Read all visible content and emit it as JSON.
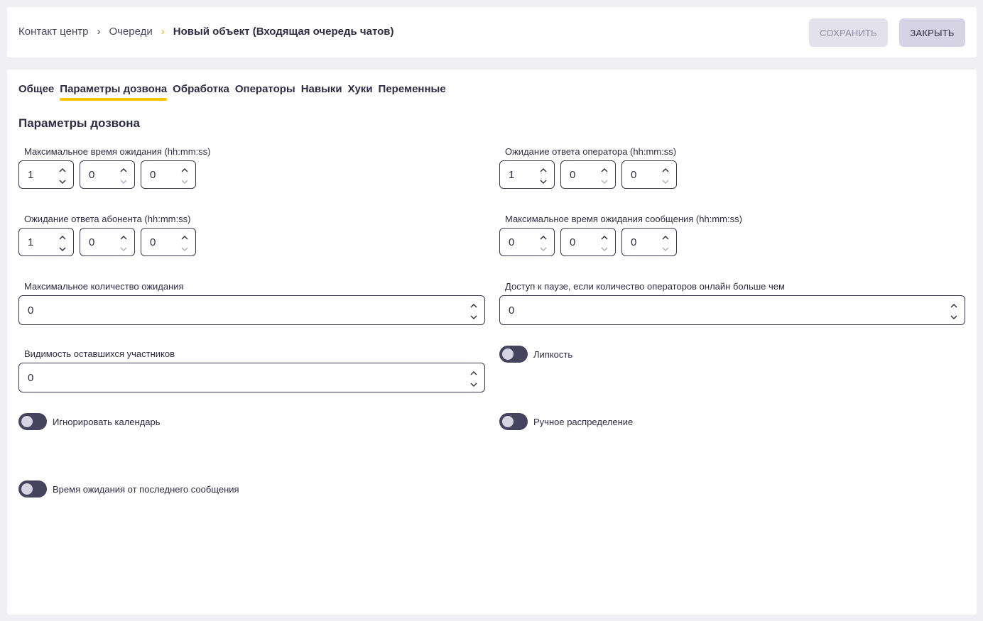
{
  "breadcrumb": {
    "items": [
      "Контакт центр",
      "Очереди"
    ],
    "current": "Новый объект (Входящая очередь чатов)",
    "separator": "›"
  },
  "actions": {
    "save_label": "СОХРАНИТЬ",
    "close_label": "ЗАКРЫТЬ"
  },
  "tabs": [
    "Общее",
    "Параметры дозвона",
    "Обработка",
    "Операторы",
    "Навыки",
    "Хуки",
    "Переменные"
  ],
  "active_tab": "Параметры дозвона",
  "section_title": "Параметры дозвона",
  "fields": {
    "max_wait_time": {
      "label": "Максимальное время ожидания (hh:mm:ss)",
      "hh": "1",
      "mm": "0",
      "ss": "0"
    },
    "operator_answer_wait": {
      "label": "Ожидание ответа оператора (hh:mm:ss)",
      "hh": "1",
      "mm": "0",
      "ss": "0"
    },
    "subscriber_answer_wait": {
      "label": "Ожидание ответа абонента (hh:mm:ss)",
      "hh": "1",
      "mm": "0",
      "ss": "0"
    },
    "max_message_wait": {
      "label": "Максимальное время ожидания сообщения (hh:mm:ss)",
      "hh": "0",
      "mm": "0",
      "ss": "0"
    },
    "max_wait_count": {
      "label": "Максимальное количество ожидания",
      "value": "0"
    },
    "pause_access": {
      "label": "Доступ к паузе, если количество операторов онлайн больше чем",
      "value": "0"
    },
    "remaining_visibility": {
      "label": "Видимость оставшихся участников",
      "value": "0"
    }
  },
  "toggles": {
    "stickiness": {
      "label": "Липкость",
      "on": false
    },
    "ignore_calendar": {
      "label": "Игнорировать календарь",
      "on": false
    },
    "manual_distribution": {
      "label": "Ручное распределение",
      "on": false
    },
    "wait_from_last_message": {
      "label": "Время ожидания от последнего сообщения",
      "on": false
    }
  },
  "colors": {
    "accent": "#f5c400",
    "toggle_track": "#46435f",
    "border": "#3a3852",
    "background": "#f0eff4"
  },
  "icons": {
    "spin_up": "chevron-up-icon",
    "spin_down": "chevron-down-icon"
  }
}
